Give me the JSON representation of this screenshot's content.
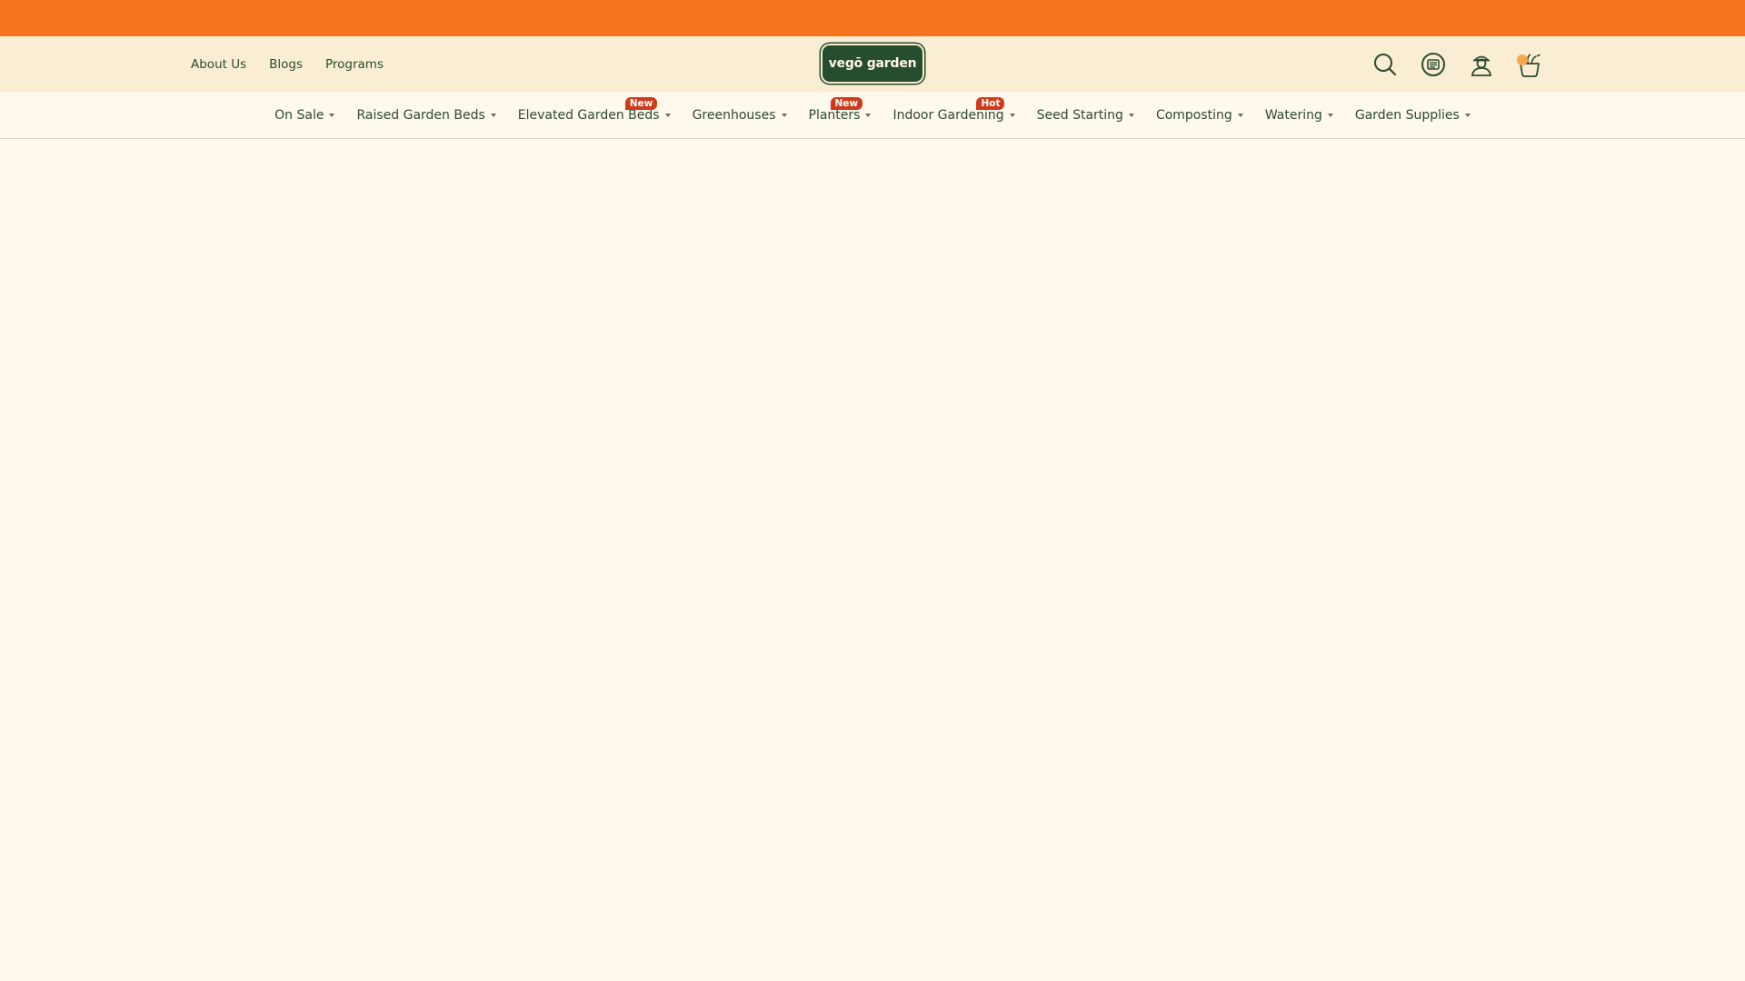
{
  "header": {
    "links": [
      "About Us",
      "Blogs",
      "Programs"
    ],
    "logo_text": "vegō garden",
    "icons": [
      "search-icon",
      "globe-icon",
      "account-icon",
      "cart-icon"
    ]
  },
  "nav": {
    "items": [
      {
        "label": "On Sale",
        "badge": ""
      },
      {
        "label": "Raised Garden Beds",
        "badge": ""
      },
      {
        "label": "Elevated Garden Beds",
        "badge": "New"
      },
      {
        "label": "Greenhouses",
        "badge": ""
      },
      {
        "label": "Planters",
        "badge": "New"
      },
      {
        "label": "Indoor Gardening",
        "badge": "Hot"
      },
      {
        "label": "Seed Starting",
        "badge": ""
      },
      {
        "label": "Composting",
        "badge": ""
      },
      {
        "label": "Watering",
        "badge": ""
      },
      {
        "label": "Garden Supplies",
        "badge": ""
      }
    ]
  },
  "colors": {
    "promo_bar": "#f7741e",
    "header_bg": "#f9eed3",
    "brand_green": "#264d2d",
    "badge": "#cf3b1a",
    "page_bg": "#fff8ec"
  }
}
